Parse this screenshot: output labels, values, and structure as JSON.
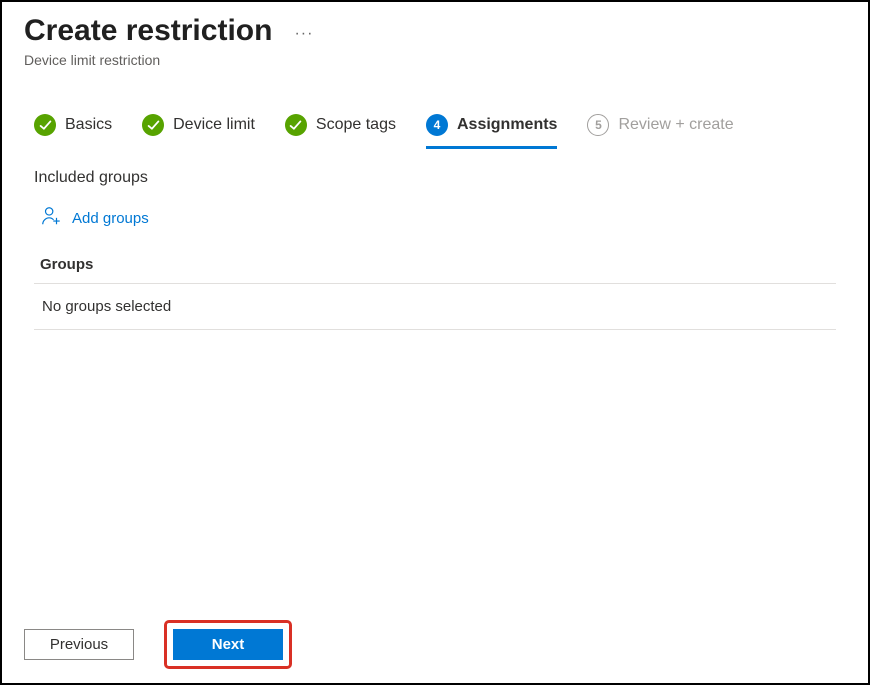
{
  "header": {
    "title": "Create restriction",
    "subtitle": "Device limit restriction",
    "more_label": "···"
  },
  "wizard": {
    "steps": [
      {
        "label": "Basics",
        "state": "done"
      },
      {
        "label": "Device limit",
        "state": "done"
      },
      {
        "label": "Scope tags",
        "state": "done"
      },
      {
        "label": "Assignments",
        "state": "current",
        "number": "4"
      },
      {
        "label": "Review + create",
        "state": "future",
        "number": "5"
      }
    ]
  },
  "assignments": {
    "included_groups_heading": "Included groups",
    "add_groups_label": "Add groups",
    "groups_column_header": "Groups",
    "empty_message": "No groups selected"
  },
  "footer": {
    "previous_label": "Previous",
    "next_label": "Next"
  }
}
